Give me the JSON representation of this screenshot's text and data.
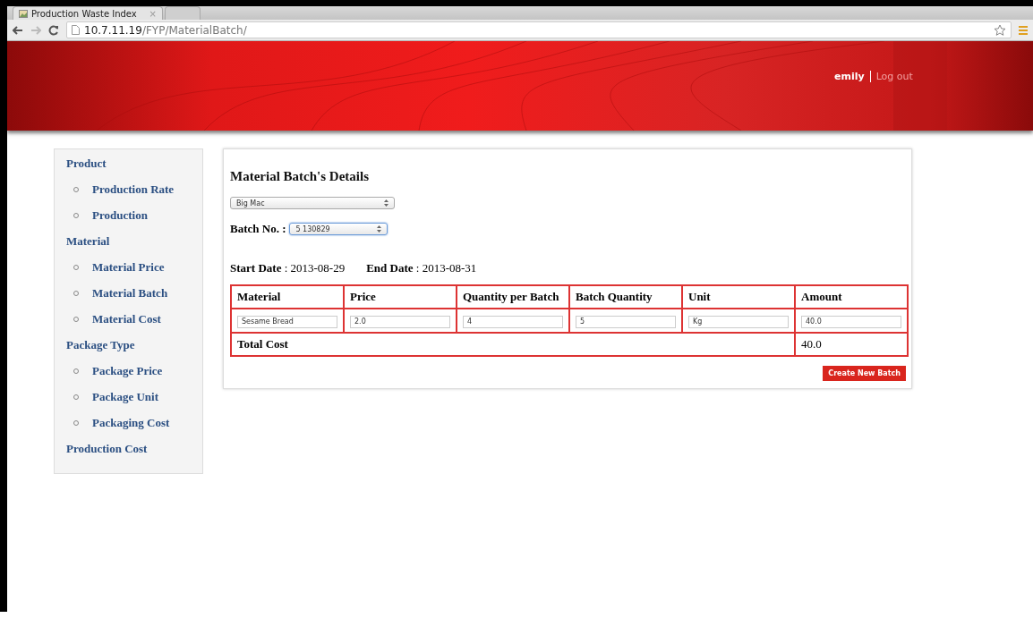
{
  "browser": {
    "tabs": [
      {
        "title": "Production Waste Index",
        "selected": true
      },
      {
        "selected": false
      }
    ],
    "close_glyph": "×",
    "url_host": "10.7.11.19",
    "url_path": "/FYP/MaterialBatch/"
  },
  "header": {
    "user": "emily",
    "logout": "Log out"
  },
  "sidebar": {
    "items": [
      {
        "label": "Product",
        "children": [
          {
            "label": "Production Rate"
          },
          {
            "label": "Production"
          }
        ]
      },
      {
        "label": "Material",
        "children": [
          {
            "label": "Material Price"
          },
          {
            "label": "Material Batch"
          },
          {
            "label": "Material Cost"
          }
        ]
      },
      {
        "label": "Package Type",
        "children": [
          {
            "label": "Package Price"
          },
          {
            "label": "Package Unit"
          },
          {
            "label": "Packaging Cost"
          }
        ]
      },
      {
        "label": "Production Cost"
      }
    ]
  },
  "main": {
    "title": "Material Batch's Details",
    "product_select": "Big Mac",
    "batch_label": "Batch No. :",
    "batch_select": "5 130829",
    "start_date": "**Start Date** : 2013-08-29",
    "end_date": "**End Date** : 2013-08-31",
    "table": {
      "columns": [
        "Material",
        "Price",
        "Quantity per Batch",
        "Batch Quantity",
        "Unit",
        "Amount"
      ],
      "rows": [
        [
          "Sesame Bread",
          "2.0",
          "4",
          "5",
          "Kg",
          "40.0"
        ]
      ],
      "total_label": "Total Cost",
      "total_value": "40.0"
    },
    "button": "Create New Batch"
  }
}
